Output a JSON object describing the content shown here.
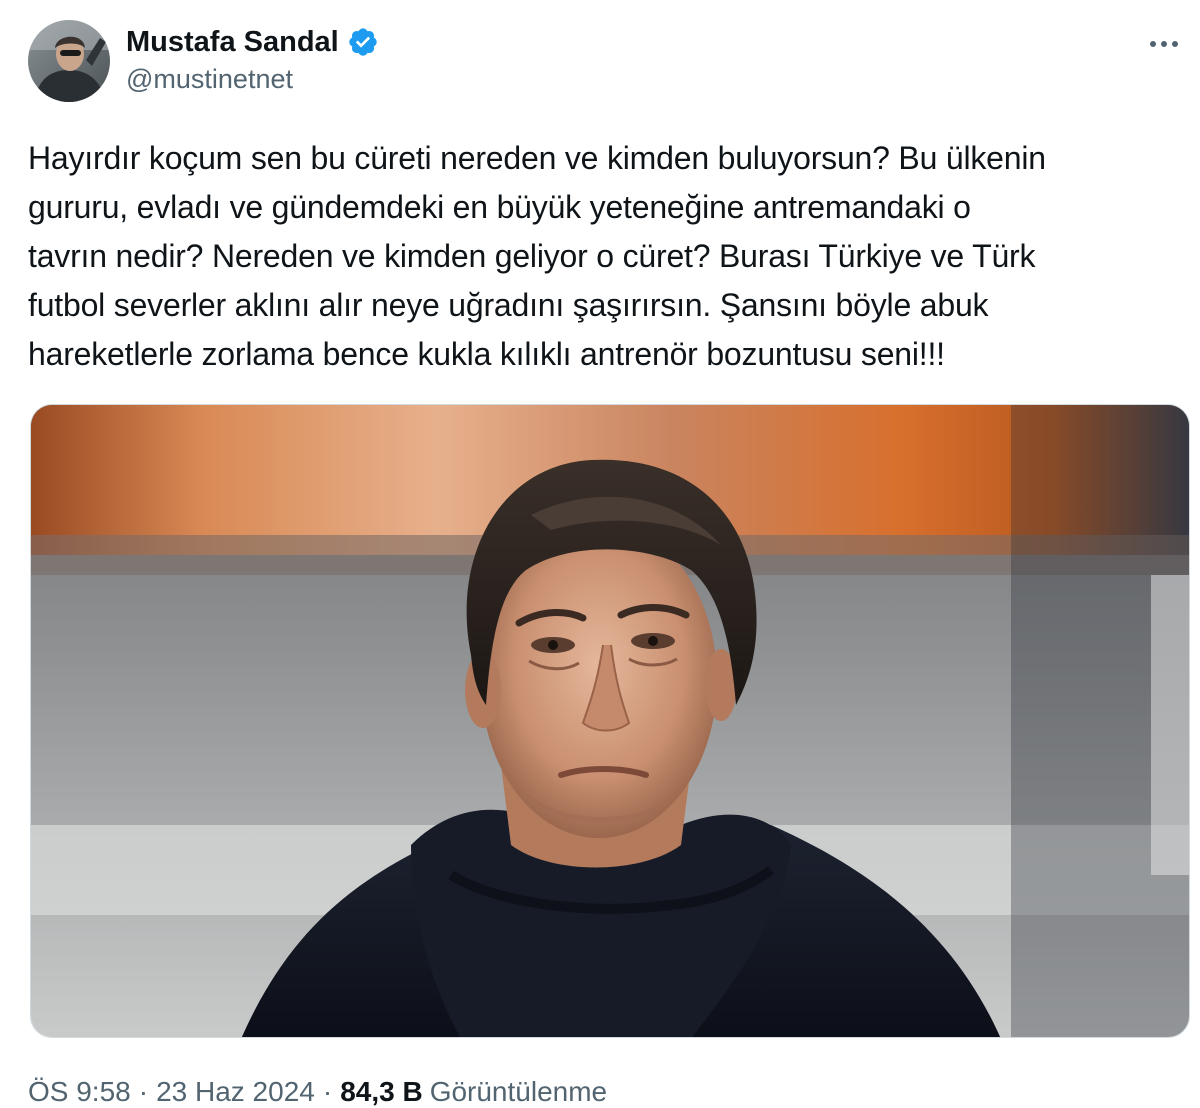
{
  "author": {
    "display_name": "Mustafa Sandal",
    "handle": "@mustinetnet",
    "verified": true,
    "avatar_icon": "profile-photo"
  },
  "more_icon": "more-horizontal-icon",
  "tweet": {
    "text": "Hayırdır koçum sen bu cüreti nereden ve kimden buluyorsun? Bu ülkenin\ngururu, evladı ve gündemdeki en büyük yeteneğine antremandaki o\ntavrın nedir? Nereden ve kimden geliyor o cüret? Burası Türkiye ve Türk\nfutbol severler aklını alır neye uğradını şaşırırsın. Şansını böyle abuk\nhareketlerle zorlama bence kukla kılıklı antrenör bozuntusu seni!!!"
  },
  "meta": {
    "time": "ÖS 9:58",
    "separator": "·",
    "date": "23 Haz 2024",
    "views_count": "84,3 B",
    "views_label": "Görüntülenme"
  },
  "colors": {
    "text_primary": "#0f1419",
    "text_secondary": "#536471",
    "verified_blue": "#1d9bf0"
  }
}
